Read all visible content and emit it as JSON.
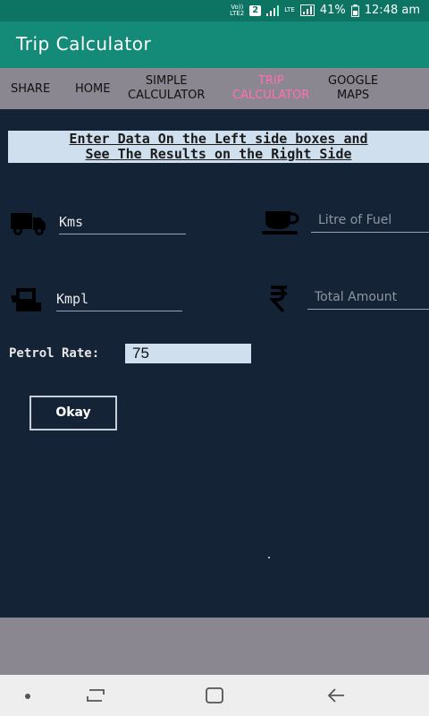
{
  "status_bar": {
    "carrier_top": "Vo))",
    "carrier_bottom": "LTE2",
    "sim": "2",
    "lte": "LTE",
    "battery": "41%",
    "time": "12:48 am"
  },
  "app_bar": {
    "title": "Trip Calculator"
  },
  "tabs": [
    {
      "label": "SHARE"
    },
    {
      "label": "HOME"
    },
    {
      "line1": "SIMPLE",
      "line2": "CALCULATOR"
    },
    {
      "line1": "TRIP",
      "line2": "CALCULATOR",
      "active": true
    },
    {
      "line1": "GOOGLE",
      "line2": "MAPS"
    }
  ],
  "banner": {
    "line1": "Enter Data On the Left side boxes and",
    "line2": "See The Results on the Right Side"
  },
  "fields": {
    "kms": "Kms",
    "litre_placeholder": "Litre of Fuel",
    "kmpl": "Kmpl",
    "total_placeholder": "Total Amount"
  },
  "petrol": {
    "label": "Petrol Rate:",
    "value": "75"
  },
  "okay_button": "Okay",
  "icons": {
    "truck": "truck-icon",
    "cup": "cup-icon",
    "fuel": "fuel-pump-icon",
    "rupee": "rupee-icon"
  },
  "colors": {
    "accent": "#148a79",
    "active_tab": "#ff6fb3",
    "background": "#142436"
  }
}
